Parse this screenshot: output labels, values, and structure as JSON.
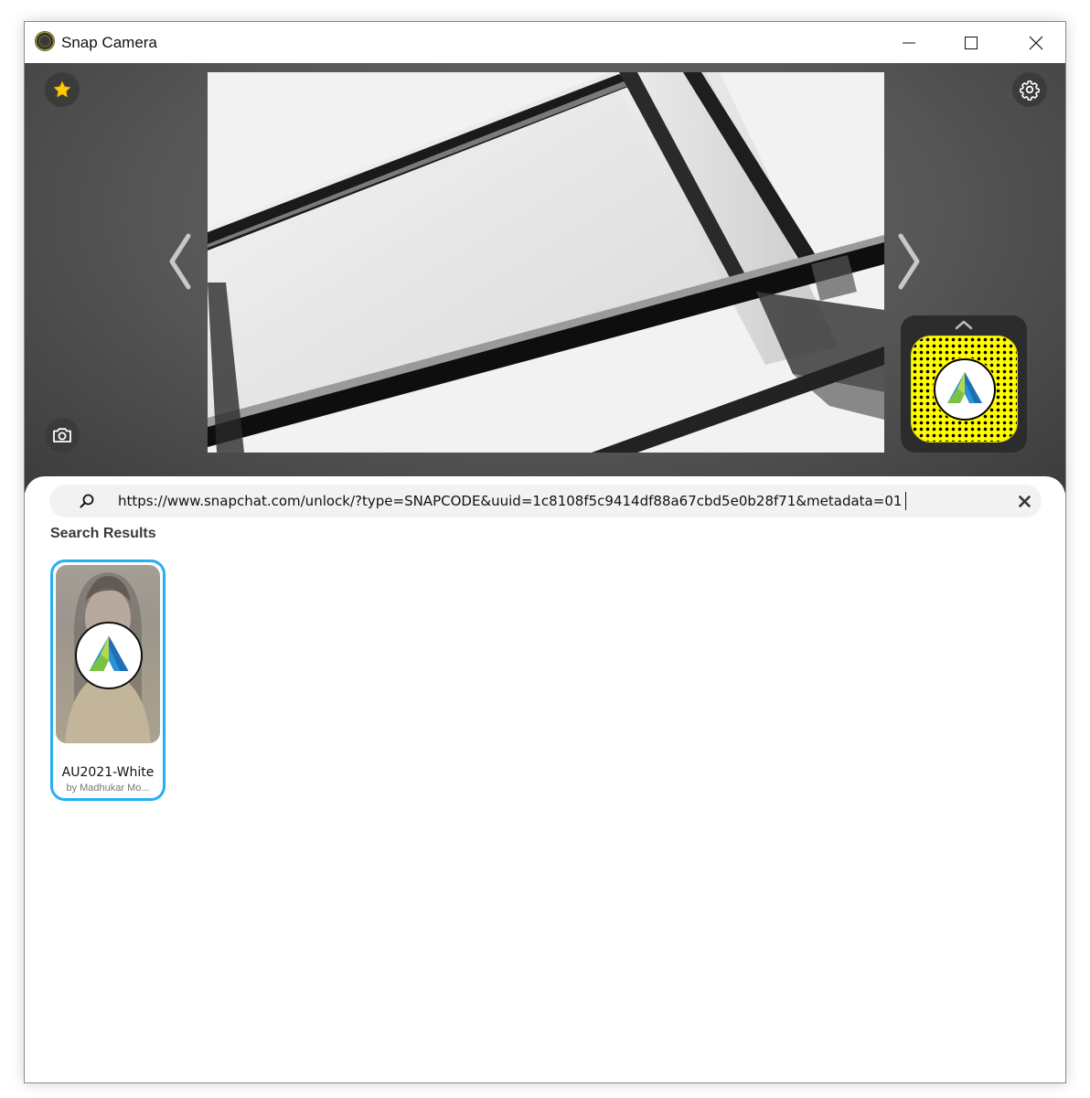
{
  "window": {
    "title": "Snap Camera",
    "controls": [
      "minimize-icon",
      "maximize-icon",
      "close-icon"
    ]
  },
  "camera": {
    "favorites_icon": "star-icon",
    "settings_icon": "gear-icon",
    "snapshot_icon": "camera-icon",
    "prev_icon": "chevron-left-icon",
    "next_icon": "chevron-right-icon",
    "lens_tile_icon": "chevron-up-icon"
  },
  "search": {
    "value": "https://www.snapchat.com/unlock/?type=SNAPCODE&uuid=1c8108f5c9414df88a67cbd5e0b28f71&metadata=01",
    "icon": "search-icon",
    "clear_icon": "close-icon"
  },
  "results": {
    "title": "Search Results",
    "items": [
      {
        "name": "AU2021-White",
        "author": "by Madhukar Mo..."
      }
    ]
  },
  "colors": {
    "accent": "#27aef2",
    "snapcode_yellow": "#fffc00",
    "star_yellow": "#ffcc00"
  }
}
